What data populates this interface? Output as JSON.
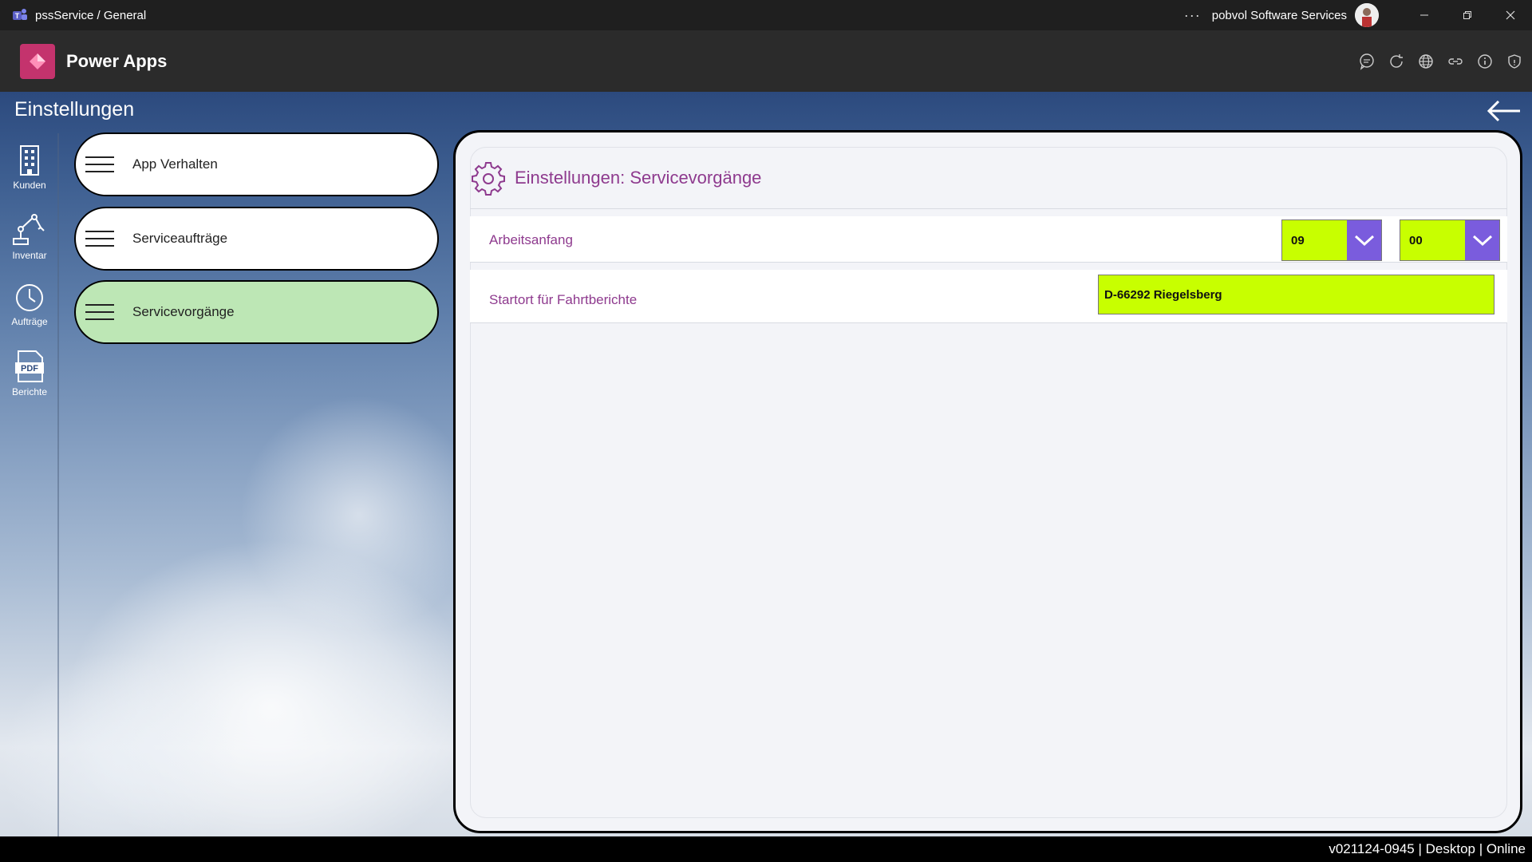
{
  "titlebar": {
    "title": "pssService / General",
    "more": "···",
    "org": "pobvol Software Services"
  },
  "header": {
    "app_name": "Power Apps",
    "icons": [
      "chat-icon",
      "refresh-icon",
      "globe-icon",
      "link-icon",
      "info-icon",
      "shield-icon"
    ]
  },
  "page": {
    "title": "Einstellungen"
  },
  "rail": {
    "items": [
      {
        "label": "Kunden",
        "icon": "building-icon"
      },
      {
        "label": "Inventar",
        "icon": "robot-arm-icon"
      },
      {
        "label": "Aufträge",
        "icon": "clock-icon"
      },
      {
        "label": "Berichte",
        "icon": "pdf-icon"
      }
    ]
  },
  "menu": {
    "items": [
      {
        "label": "App Verhalten",
        "active": false
      },
      {
        "label": "Serviceaufträge",
        "active": false
      },
      {
        "label": "Servicevorgänge",
        "active": true
      }
    ]
  },
  "panel": {
    "title": "Einstellungen: Servicevorgänge",
    "work_start": {
      "label": "Arbeitsanfang",
      "hour": "09",
      "minute": "00"
    },
    "start_location": {
      "label": "Startort für Fahrtberichte",
      "value": "D-66292 Riegelsberg"
    }
  },
  "colors": {
    "accent_purple": "#8e3a8e",
    "field_highlight": "#c8ff00",
    "dropdown_button": "#7a5cdd",
    "active_menu": "#bde7b5",
    "powerapps_logo": "#c4336d"
  },
  "statusbar": {
    "text": "v021124-0945 | Desktop | Online"
  }
}
